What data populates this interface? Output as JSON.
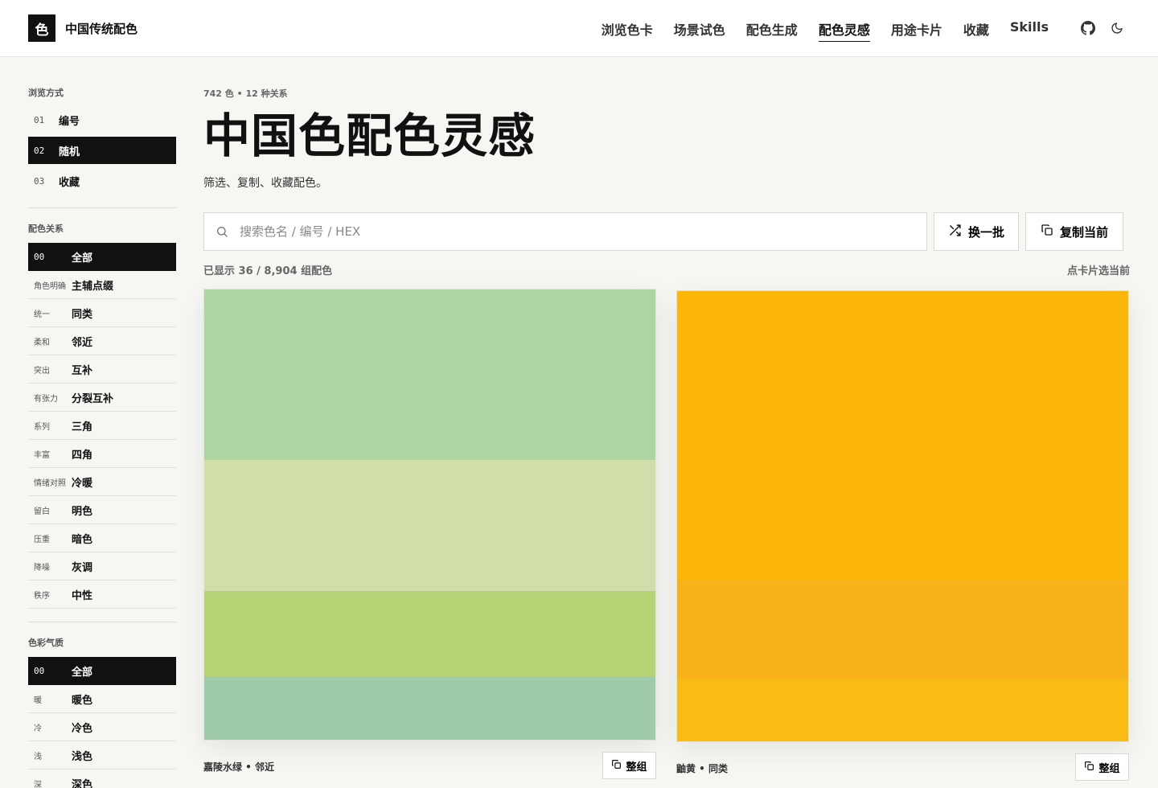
{
  "header": {
    "logo_char": "色",
    "site_title": "中国传统配色",
    "nav": [
      {
        "label": "浏览色卡"
      },
      {
        "label": "场景试色"
      },
      {
        "label": "配色生成"
      },
      {
        "label": "配色灵感",
        "active": true
      },
      {
        "label": "用途卡片"
      },
      {
        "label": "收藏"
      },
      {
        "label": "Skills"
      }
    ],
    "icons": [
      "github-icon",
      "moon-icon"
    ]
  },
  "sidebar": {
    "browse_title": "浏览方式",
    "browse_modes": [
      {
        "num": "01",
        "label": "编号"
      },
      {
        "num": "02",
        "label": "随机",
        "active": true
      },
      {
        "num": "03",
        "label": "收藏"
      }
    ],
    "relation_title": "配色关系",
    "relations": [
      {
        "tag": "00",
        "label": "全部",
        "active": true
      },
      {
        "tag": "角色明确",
        "label": "主辅点缀"
      },
      {
        "tag": "统一",
        "label": "同类"
      },
      {
        "tag": "柔和",
        "label": "邻近"
      },
      {
        "tag": "突出",
        "label": "互补"
      },
      {
        "tag": "有张力",
        "label": "分裂互补"
      },
      {
        "tag": "系列",
        "label": "三角"
      },
      {
        "tag": "丰富",
        "label": "四角"
      },
      {
        "tag": "情绪对照",
        "label": "冷暖"
      },
      {
        "tag": "留白",
        "label": "明色"
      },
      {
        "tag": "压重",
        "label": "暗色"
      },
      {
        "tag": "降噪",
        "label": "灰调"
      },
      {
        "tag": "秩序",
        "label": "中性"
      }
    ],
    "mood_title": "色彩气质",
    "moods": [
      {
        "tag": "00",
        "label": "全部",
        "active": true
      },
      {
        "tag": "暖",
        "label": "暖色"
      },
      {
        "tag": "冷",
        "label": "冷色"
      },
      {
        "tag": "浅",
        "label": "浅色"
      },
      {
        "tag": "深",
        "label": "深色"
      }
    ]
  },
  "main": {
    "meta": "742 色 • 12 种关系",
    "title": "中国色配色灵感",
    "subtitle": "筛选、复制、收藏配色。",
    "search_placeholder": "搜索色名 / 编号 / HEX",
    "shuffle_label": "换一批",
    "copy_current_label": "复制当前",
    "count_text": "已显示 36 / 8,904 组配色",
    "hint_text": "点卡片选当前",
    "cards": [
      {
        "name": "嘉陵水绿 • 邻近",
        "copy_label": "整组",
        "swatches": [
          {
            "color": "#add5a2",
            "weight": 213
          },
          {
            "color": "#d0dfaa",
            "weight": 163
          },
          {
            "color": "#b8d276",
            "weight": 107
          },
          {
            "color": "#9ecbaa",
            "weight": 79
          }
        ]
      },
      {
        "name": "鼬黄 • 同类",
        "copy_label": "整组",
        "swatches": [
          {
            "color": "#fcb70a",
            "weight": 361
          },
          {
            "color": "#f9b31a",
            "weight": 124
          },
          {
            "color": "#f8bc15",
            "weight": 77
          }
        ]
      }
    ]
  }
}
